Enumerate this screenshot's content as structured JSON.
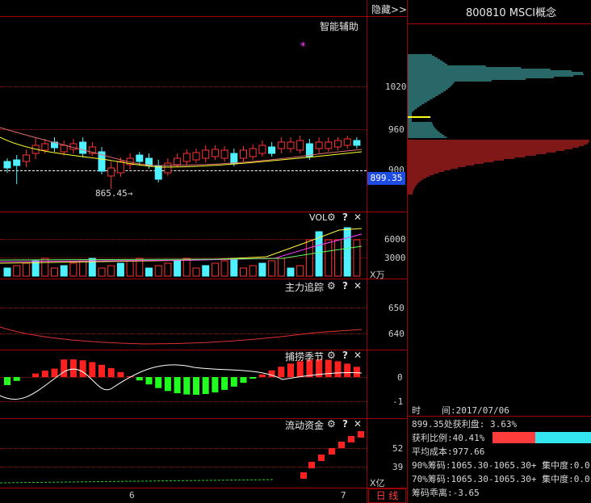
{
  "header": {
    "hide_label": "隐藏>>",
    "stock_title": "800810 MSCI概念",
    "assist_label": "智能辅助",
    "star": "*"
  },
  "price_panel": {
    "y_ticks": [
      "1020",
      "960",
      "900"
    ],
    "current_price": "899.35",
    "low_label": "865.45→"
  },
  "vol_panel": {
    "title": "VOL",
    "y_ticks": [
      "6000",
      "3000"
    ],
    "unit": "X万"
  },
  "main_force_panel": {
    "title": "主力追踪",
    "y_ticks": [
      "650",
      "640"
    ]
  },
  "season_panel": {
    "title": "捕捞季节",
    "y_ticks": [
      "0",
      "-1"
    ]
  },
  "flow_panel": {
    "title": "流动资金",
    "y_ticks": [
      "52",
      "39"
    ],
    "unit": "X亿"
  },
  "x_axis": {
    "labels": [
      "6",
      "7"
    ],
    "period_button": "日 线"
  },
  "icons": {
    "gear": "⚙",
    "help": "?",
    "close": "✕"
  },
  "chip_info": {
    "time_label": "时",
    "time_label2": "间:2017/07/06",
    "profit_at": "899.35处获利盘: 3.63%",
    "profit_ratio": "获利比例:40.41%",
    "avg_cost": "平均成本:977.66",
    "chips90": "90%筹码:1065.30-1065.30+ 集中度:0.0",
    "chips70": "70%筹码:1065.30-1065.30+ 集中度:0.0",
    "deviation": "筹码乖离:-3.65"
  },
  "colors": {
    "up": "#ff3333",
    "down": "#4ff0ff",
    "border": "#a00000",
    "profit_bar": "#ff3c3c",
    "loss_bar": "#33e6f0"
  }
}
